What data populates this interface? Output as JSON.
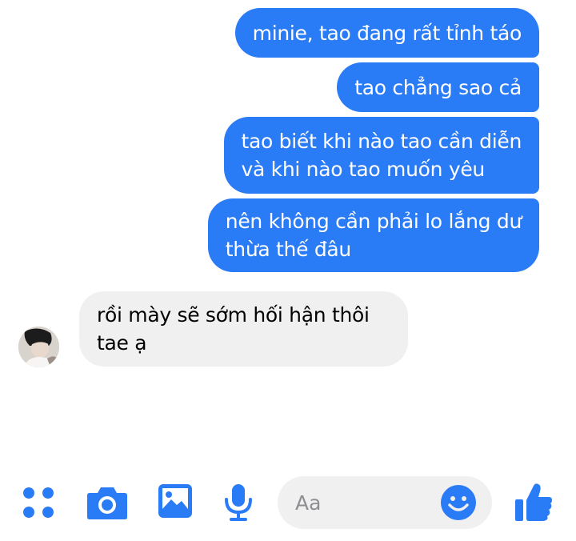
{
  "messages": [
    {
      "direction": "outgoing",
      "text": "minie, tao đang rất tỉnh táo"
    },
    {
      "direction": "outgoing",
      "text": "tao chẳng sao cả"
    },
    {
      "direction": "outgoing",
      "lines": [
        "tao biết khi nào tao cần diễn",
        "và khi nào tao muốn yêu"
      ]
    },
    {
      "direction": "outgoing",
      "lines": [
        "nên không cần phải lo lắng dư",
        "thừa thế đâu"
      ]
    },
    {
      "direction": "incoming",
      "lines": [
        "rồi mày sẽ sớm hối hận thôi",
        "tae ạ"
      ]
    }
  ],
  "composer": {
    "placeholder": "Aa",
    "value": ""
  },
  "toolbar": {
    "icons": [
      "apps-icon",
      "camera-icon",
      "photo-icon",
      "microphone-icon",
      "emoji-icon",
      "thumbs-up-icon"
    ]
  },
  "colors": {
    "accent": "#2a7bf6",
    "incoming_bubble": "#f0f0f0",
    "composer_bg": "#f0f0f0",
    "placeholder": "#8e8e93"
  }
}
